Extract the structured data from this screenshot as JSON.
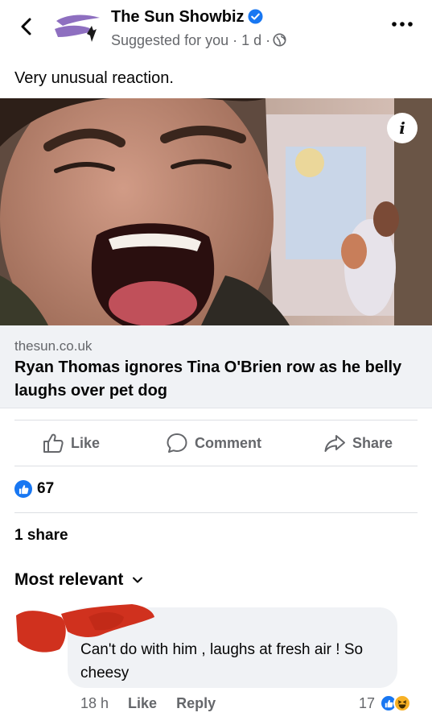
{
  "post": {
    "page_name": "The Sun Showbiz",
    "meta": "Suggested for you · 1 d ·",
    "caption": "Very unusual reaction."
  },
  "link": {
    "domain": "thesun.co.uk",
    "headline": "Ryan Thomas ignores Tina O'Brien row as he belly laughs over pet dog"
  },
  "actions": {
    "like": "Like",
    "comment": "Comment",
    "share": "Share"
  },
  "stats": {
    "reactions": "67",
    "shares": "1 share"
  },
  "comments": {
    "sort_label": "Most relevant",
    "items": [
      {
        "text": "Can't do with him , laughs at fresh air ! So cheesy",
        "time": "18 h",
        "like": "Like",
        "reply": "Reply",
        "reaction_count": "17"
      }
    ]
  },
  "colors": {
    "accent": "#1877f2",
    "secondary_text": "#65676b",
    "link_bg": "#f0f2f5",
    "redaction": "#d0311e"
  },
  "icons": [
    "back-arrow-icon",
    "verified-badge-icon",
    "globe-icon",
    "more-icon",
    "info-icon",
    "thumbs-up-icon",
    "comment-icon",
    "share-arrow-icon",
    "chevron-down-icon",
    "haha-icon"
  ]
}
